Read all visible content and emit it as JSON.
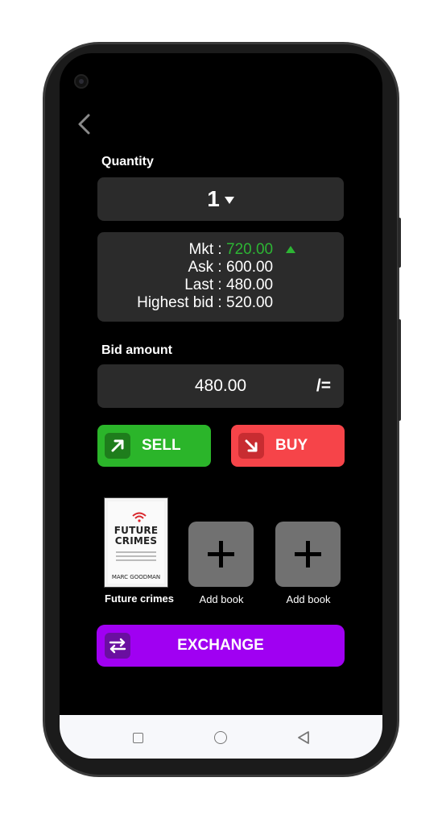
{
  "quantity": {
    "label": "Quantity",
    "value": "1"
  },
  "quote": {
    "mkt_label": "Mkt :",
    "mkt_value": "720.00",
    "mkt_trend": "up",
    "ask_label": "Ask :",
    "ask_value": "600.00",
    "last_label": "Last :",
    "last_value": "480.00",
    "highest_bid_label": "Highest bid :",
    "highest_bid_value": "520.00"
  },
  "bid": {
    "label": "Bid amount",
    "value": "480.00",
    "unit": "/="
  },
  "actions": {
    "sell_label": "SELL",
    "buy_label": "BUY",
    "exchange_label": "EXCHANGE"
  },
  "books": {
    "selected": {
      "caption": "Future crimes",
      "cover_title_line1": "FUTURE",
      "cover_title_line2": "CRIMES",
      "cover_author": "MARC GOODMAN"
    },
    "add_slots": [
      {
        "caption": "Add book"
      },
      {
        "caption": "Add book"
      }
    ]
  },
  "colors": {
    "sell": "#2bb52a",
    "buy": "#f64449",
    "exchange": "#a000f2",
    "positive": "#2db534",
    "panel": "#2b2b2b",
    "add_tile": "#717171"
  },
  "icons": {
    "back": "chevron-left-icon",
    "sell": "arrow-up-right-icon",
    "buy": "arrow-down-right-icon",
    "exchange": "swap-arrows-icon",
    "add": "plus-icon",
    "trend": "triangle-up-icon"
  }
}
